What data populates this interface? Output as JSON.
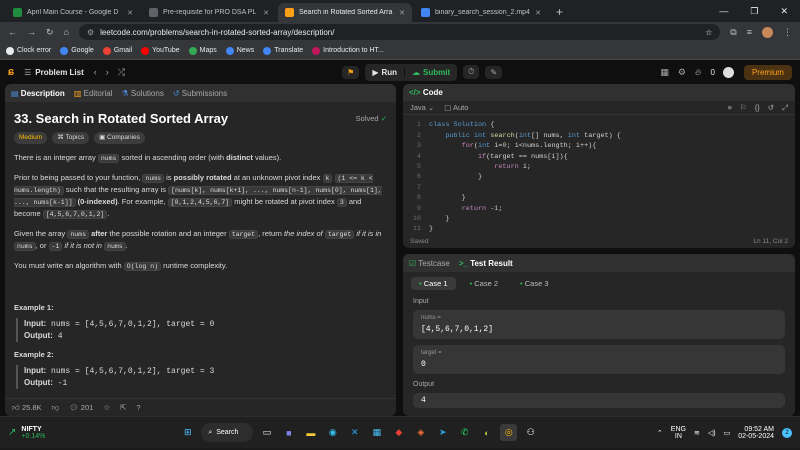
{
  "browser": {
    "tabs": [
      {
        "title": "April Main Course - Google D",
        "color": "#1e8e3e"
      },
      {
        "title": "Pre-requisite for PRO DSA PL",
        "color": "#5f6368"
      },
      {
        "title": "Search in Rotated Sorted Arra",
        "color": "#ffa116",
        "active": true
      },
      {
        "title": "binary_search_session_2.mp4",
        "color": "#4285f4"
      }
    ],
    "url": "leetcode.com/problems/search-in-rotated-sorted-array/description/",
    "bookmarks": [
      {
        "label": "Clock error",
        "color": "#e8eaed"
      },
      {
        "label": "Google",
        "color": "#4285f4"
      },
      {
        "label": "Gmail",
        "color": "#ea4335"
      },
      {
        "label": "YouTube",
        "color": "#ff0000"
      },
      {
        "label": "Maps",
        "color": "#34a853"
      },
      {
        "label": "News",
        "color": "#4285f4"
      },
      {
        "label": "Translate",
        "color": "#4285f4"
      },
      {
        "label": "Introduction to HT...",
        "color": "#c2185b"
      }
    ]
  },
  "header": {
    "problem_list": "Problem List",
    "run": "Run",
    "submit": "Submit",
    "streak": "0",
    "premium": "Premium"
  },
  "left": {
    "tabs": [
      "Description",
      "Editorial",
      "Solutions",
      "Submissions"
    ],
    "title": "33. Search in Rotated Sorted Array",
    "solved": "Solved",
    "chips": [
      "Medium",
      "Topics",
      "Companies"
    ],
    "p1a": "There is an integer array",
    "p1b": "nums",
    "p1c": "sorted in ascending order (with",
    "p1d": "distinct",
    "p1e": "values).",
    "p2a": "Prior to being passed to your function,",
    "p2b": "nums",
    "p2c": "is",
    "p2d": "possibly rotated",
    "p2e": "at an unknown pivot index",
    "p2f": "k",
    "p2g": "(1 <= k < nums.length)",
    "p2h": "such that the resulting array is",
    "p2i": "[nums[k], nums[k+1], ..., nums[n-1], nums[0], nums[1], ..., nums[k-1]]",
    "p2j": "(0-indexed)",
    "p2k": ". For example,",
    "p2l": "[0,1,2,4,5,6,7]",
    "p2m": "might be rotated at pivot index",
    "p2n": "3",
    "p2o": "and become",
    "p2p": "[4,5,6,7,0,1,2]",
    "p3a": "Given the array",
    "p3b": "nums",
    "p3c": "after",
    "p3d": "the possible rotation and an integer",
    "p3e": "target",
    "p3f": ", return",
    "p3g": "the index of",
    "p3h": "target",
    "p3i": "if it is in",
    "p3j": "nums",
    "p3k": ", or",
    "p3l": "-1",
    "p3m": "if it is not in",
    "p3n": "nums",
    "p4a": "You must write an algorithm with",
    "p4b": "O(log n)",
    "p4c": "runtime complexity.",
    "ex1_title": "Example 1:",
    "ex1_input_label": "Input:",
    "ex1_input": "nums = [4,5,6,7,0,1,2], target = 0",
    "ex1_output_label": "Output:",
    "ex1_output": "4",
    "ex2_title": "Example 2:",
    "ex2_input_label": "Input:",
    "ex2_input": "nums = [4,5,6,7,0,1,2], target = 3",
    "ex2_output_label": "Output:",
    "ex2_output": "-1",
    "likes": "25.8K",
    "comments": "201"
  },
  "code": {
    "tab": "Code",
    "lang": "Java",
    "auto": "Auto",
    "lines": [
      "1",
      "2",
      "3",
      "4",
      "5",
      "6",
      "7",
      "8",
      "9",
      "10",
      "11"
    ],
    "saved": "Saved",
    "cursor": "Ln 11, Col 2"
  },
  "test": {
    "tabs": [
      "Testcase",
      "Test Result"
    ],
    "cases": [
      "Case 1",
      "Case 2",
      "Case 3"
    ],
    "input_label": "Input",
    "nums_label": "nums =",
    "nums_val": "[4,5,6,7,0,1,2]",
    "target_label": "target =",
    "target_val": "0",
    "output_label": "Output",
    "output_val": "4"
  },
  "taskbar": {
    "stock": "NIFTY",
    "stock_change": "+0.14%",
    "search": "Search",
    "lang1": "ENG",
    "lang2": "IN",
    "time": "09:52 AM",
    "date": "02-05-2024",
    "badge": "2"
  }
}
